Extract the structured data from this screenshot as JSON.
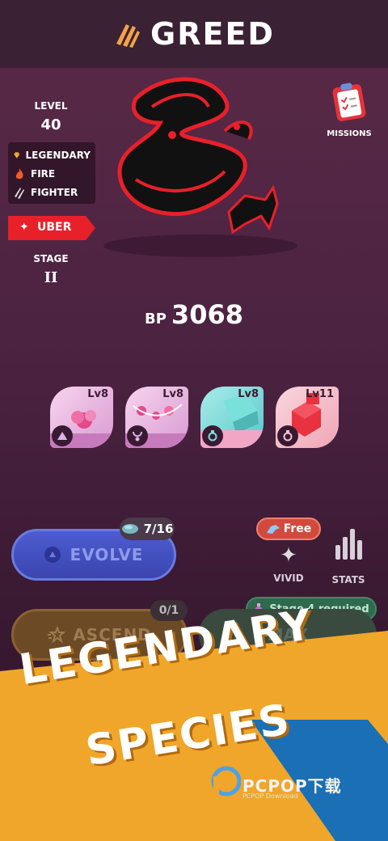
{
  "header": {
    "title": "GREED",
    "icon": "claw-marks-icon"
  },
  "stats": {
    "level_label": "LEVEL",
    "level_value": "40",
    "traits": [
      {
        "icon": "diamond-icon",
        "label": "LEGENDARY"
      },
      {
        "icon": "fire-icon",
        "label": "FIRE"
      },
      {
        "icon": "claw-icon",
        "label": "FIGHTER"
      }
    ],
    "rank_label": "UBER",
    "stage_label": "STAGE",
    "stage_value": "II"
  },
  "missions": {
    "label": "MISSIONS",
    "icon": "clipboard-checklist-icon"
  },
  "bp": {
    "label": "BP",
    "value": "3068"
  },
  "equipment": [
    {
      "level": "Lv8",
      "slot_icon": "hat-icon",
      "color": "#f0c3e6"
    },
    {
      "level": "Lv8",
      "slot_icon": "necklace-icon",
      "color": "#f0c3e6"
    },
    {
      "level": "Lv8",
      "slot_icon": "ring-icon",
      "color": "#8fe0df"
    },
    {
      "level": "Lv11",
      "slot_icon": "ring-icon",
      "color": "#f6c4cf"
    }
  ],
  "actions": {
    "evolve_label": "EVOLVE",
    "evolve_count": "7/16",
    "free_label": "Free",
    "vivid_label": "VIVID",
    "stats_label": "STATS",
    "stage_requirement": "Stage 4 required",
    "ascend_label": "ASCEND",
    "ascend_count": "0/1",
    "max_label": "MAX"
  },
  "promo": {
    "line1": "LEGENDARY",
    "line2": "SPECIES"
  },
  "watermark": {
    "text": "PCPOP下载",
    "sub": "PCPOP Download"
  },
  "colors": {
    "accent_red": "#e8202a",
    "evolve_blue": "#3a45b0",
    "banner_yellow": "#f0a62a"
  }
}
